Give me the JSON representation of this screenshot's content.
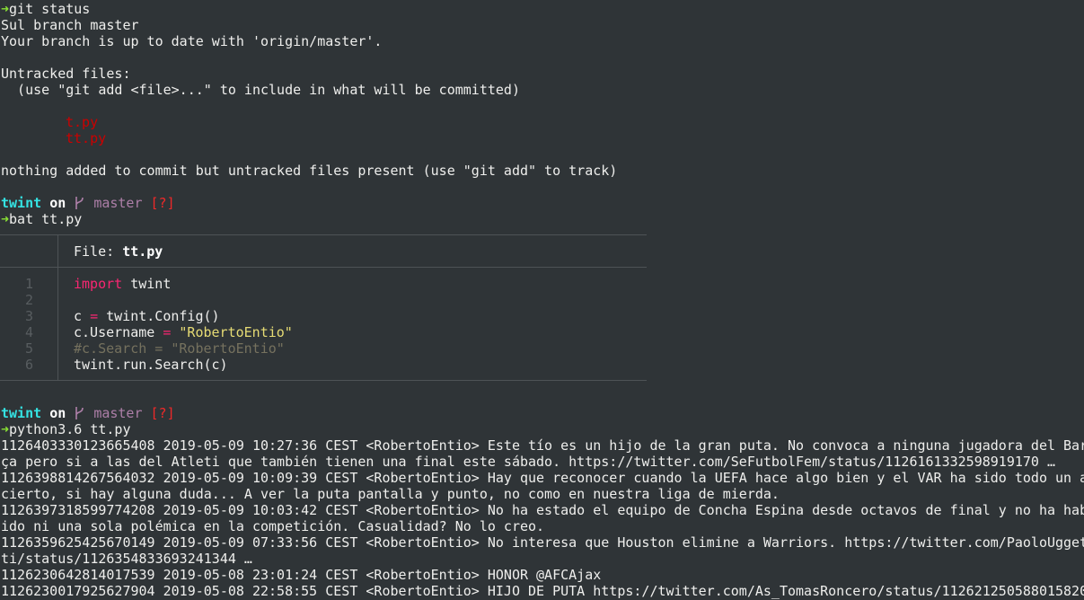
{
  "session": {
    "prompt_arrow": "➜",
    "cmd_git_status": "git status",
    "git_status_lines": [
      "Sul branch master",
      "Your branch is up to date with 'origin/master'.",
      "",
      "Untracked files:",
      "  (use \"git add <file>...\" to include in what will be committed)"
    ],
    "untracked_files": [
      "t.py",
      "tt.py"
    ],
    "nothing_added": "nothing added to commit but untracked files present (use \"git add\" to track)",
    "prompt": {
      "dir": "twint",
      "on": "on",
      "branch": "master",
      "status": "[?]"
    },
    "cmd_bat": "bat tt.py",
    "bat": {
      "file_label": "File: ",
      "file_name": "tt.py",
      "line_numbers": [
        "1",
        "2",
        "3",
        "4",
        "5",
        "6"
      ],
      "code": {
        "l1_kw": "import",
        "l1_rest": " twint",
        "l3_a": "c ",
        "l3_op": "=",
        "l3_b": " twint.Config()",
        "l4_a": "c.Username ",
        "l4_op": "=",
        "l4_sp": " ",
        "l4_str": "\"RobertoEntio\"",
        "l5_cmt": "#c.Search = \"RobertoEntio\"",
        "l6": "twint.run.Search(c)"
      }
    },
    "cmd_python": "python3.6 tt.py",
    "output_lines": [
      "1126403330123665408 2019-05-09 10:27:36 CEST <RobertoEntio> Este tío es un hijo de la gran puta. No convoca a ninguna jugadora del Bar",
      "ça pero si a las del Atleti que también tienen una final este sábado. https://twitter.com/SeFutbolFem/status/1126161332598919170 …",
      "1126398814267564032 2019-05-09 10:09:39 CEST <RobertoEntio> Hay que reconocer cuando la UEFA hace algo bien y el VAR ha sido todo un a",
      "cierto, si hay alguna duda... A ver la puta pantalla y punto, no como en nuestra liga de mierda.",
      "1126397318599774208 2019-05-09 10:03:42 CEST <RobertoEntio> No ha estado el equipo de Concha Espina desde octavos de final y no ha hab",
      "ido ni una sola polémica en la competición. Casualidad? No lo creo.",
      "1126359625425670149 2019-05-09 07:33:56 CEST <RobertoEntio> No interesa que Houston elimine a Warriors. https://twitter.com/PaoloUgget",
      "ti/status/1126354833693241344 …",
      "1126230642814017539 2019-05-08 23:01:24 CEST <RobertoEntio> HONOR @AFCAjax",
      "1126230017925627904 2019-05-08 22:58:55 CEST <RobertoEntio> HIJO DE PUTA https://twitter.com/As_TomasRoncero/status/11262125058801582​0"
    ]
  }
}
